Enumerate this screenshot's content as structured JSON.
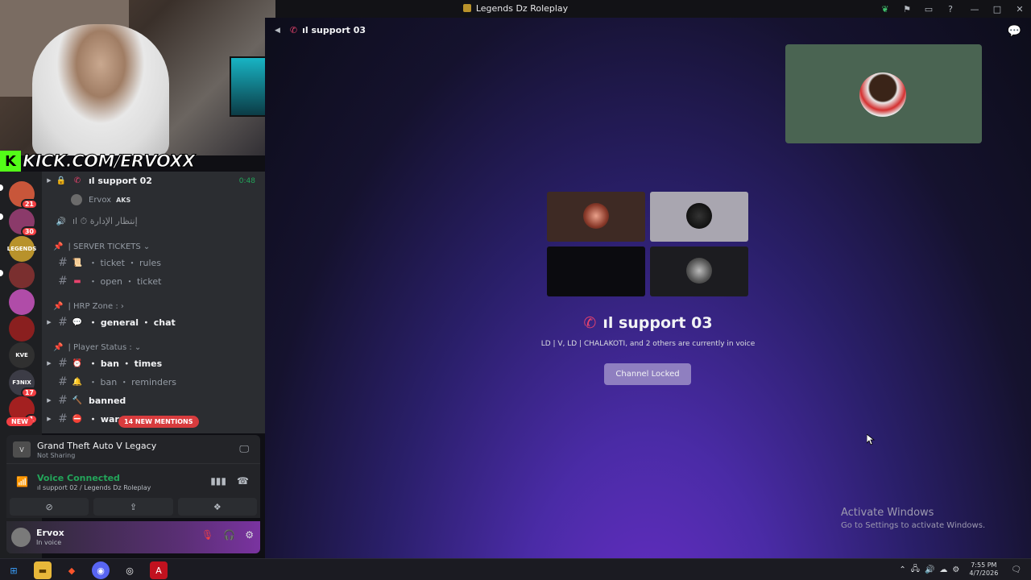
{
  "window": {
    "title": "Legends Dz Roleplay",
    "controls": [
      "—",
      "□",
      "✕"
    ]
  },
  "overlay": {
    "kick_url": "KICK.COM/ERVOXX"
  },
  "servers": [
    {
      "badge": "21",
      "color": "#c8563a"
    },
    {
      "badge": "30",
      "color": "#8b3a6a"
    },
    {
      "badge": "",
      "color": "#b8922b",
      "label": "LEGENDS"
    },
    {
      "badge": "",
      "color": "#7a2f2f"
    },
    {
      "badge": "",
      "color": "#b04ca8"
    },
    {
      "badge": "",
      "color": "#8a1f1f"
    },
    {
      "badge": "",
      "color": "#303030",
      "label": "KVE"
    },
    {
      "badge": "17",
      "color": "#3c3c46",
      "label": "F3NIX"
    },
    {
      "badge": "1",
      "color": "#a32020"
    }
  ],
  "server_new": "NEW",
  "channels": {
    "support02": {
      "name": "ıl support 02",
      "timer": "0:48"
    },
    "voice_user": {
      "name": "Ervox",
      "tag": "AKS"
    },
    "waiting": {
      "name": "ıl ⏱ إنتظار الإدارة"
    },
    "cat_tickets": "| SERVER TICKETS ⌄",
    "ticket_rules": "・ ticket ・ rules",
    "open_ticket": "・ open ・ ticket",
    "cat_hrp": "| HRP Zone : ›",
    "general_chat": "・ general ・ chat",
    "cat_player": "| Player Status : ⌄",
    "ban_times": "・ ban ・ times",
    "ban_reminders": "・ ban ・ reminders",
    "banned": "banned",
    "warnings": "・ warne"
  },
  "mentions": "14 NEW MENTIONS",
  "activity": {
    "game": "Grand Theft Auto V Legacy",
    "status": "Not Sharing"
  },
  "voice": {
    "status": "Voice Connected",
    "location": "ıl support 02 / Legends Dz Roleplay"
  },
  "user": {
    "name": "Ervox",
    "status": "In voice"
  },
  "stage": {
    "header": "ıl support 03",
    "channel_title": "ıl support 03",
    "subtitle": "LD | V, LD | CHALAKOTI, and 2 others are currently in voice",
    "locked_button": "Channel Locked"
  },
  "watermark": {
    "line1": "Activate Windows",
    "line2": "Go to Settings to activate Windows."
  },
  "taskbar": {
    "time": "7:55 PM",
    "date": "4/7/2026"
  },
  "colors": {
    "online_green": "#23a55a",
    "accent_pink": "#e8436d",
    "mention_red": "#d83c3e",
    "kick_green": "#53fc18"
  }
}
